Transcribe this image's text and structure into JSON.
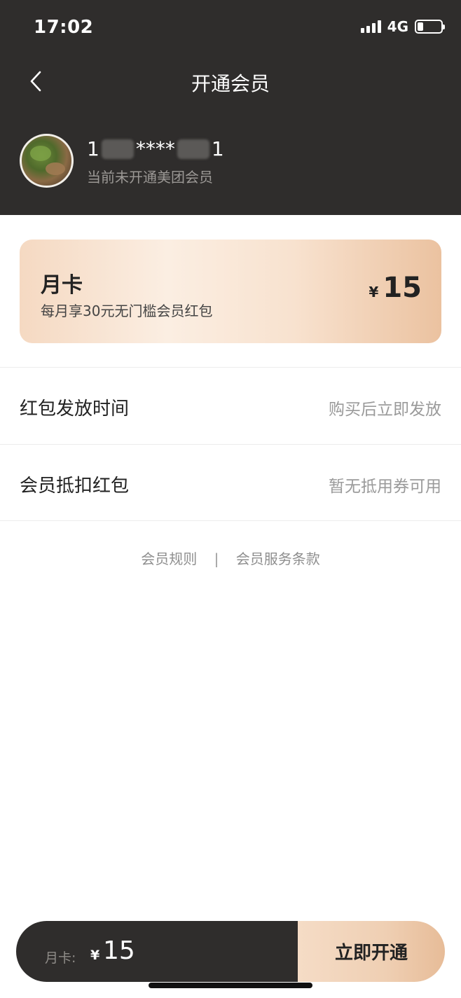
{
  "status_bar": {
    "time": "17:02",
    "network": "4G"
  },
  "nav": {
    "title": "开通会员"
  },
  "user": {
    "phone_prefix": "1",
    "phone_mask": "****",
    "phone_suffix": "1",
    "status": "当前未开通美团会员"
  },
  "plan_card": {
    "title": "月卡",
    "description": "每月享30元无门槛会员红包",
    "currency": "¥",
    "price": "15"
  },
  "rows": [
    {
      "label": "红包发放时间",
      "value": "购买后立即发放"
    },
    {
      "label": "会员抵扣红包",
      "value": "暂无抵用券可用"
    }
  ],
  "links": {
    "rules": "会员规则",
    "separator": "|",
    "terms": "会员服务条款"
  },
  "bottom_bar": {
    "plan_label": "月卡:",
    "currency": "¥",
    "price": "15",
    "cta": "立即开通"
  },
  "colors": {
    "header_bg": "#2f2d2c",
    "accent_gold": "#e7bc98",
    "muted_text": "#9a9a9a"
  }
}
